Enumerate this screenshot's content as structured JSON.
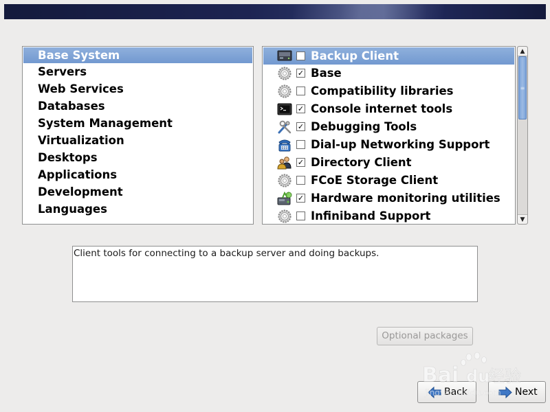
{
  "groups": [
    {
      "label": "Base System",
      "selected": true
    },
    {
      "label": "Servers"
    },
    {
      "label": "Web Services"
    },
    {
      "label": "Databases"
    },
    {
      "label": "System Management"
    },
    {
      "label": "Virtualization"
    },
    {
      "label": "Desktops"
    },
    {
      "label": "Applications"
    },
    {
      "label": "Development"
    },
    {
      "label": "Languages"
    }
  ],
  "packages": [
    {
      "label": "Backup Client",
      "checked": false,
      "icon": "backup-drive-icon",
      "selected": true
    },
    {
      "label": "Base",
      "checked": true,
      "icon": "gear-icon"
    },
    {
      "label": "Compatibility libraries",
      "checked": false,
      "icon": "gear-icon"
    },
    {
      "label": "Console internet tools",
      "checked": true,
      "icon": "terminal-icon"
    },
    {
      "label": "Debugging Tools",
      "checked": true,
      "icon": "tools-icon"
    },
    {
      "label": "Dial-up Networking Support",
      "checked": false,
      "icon": "telephone-icon"
    },
    {
      "label": "Directory Client",
      "checked": true,
      "icon": "users-icon"
    },
    {
      "label": "FCoE Storage Client",
      "checked": false,
      "icon": "gear-icon"
    },
    {
      "label": "Hardware monitoring utilities",
      "checked": true,
      "icon": "hardware-monitor-icon"
    },
    {
      "label": "Infiniband Support",
      "checked": false,
      "icon": "gear-icon"
    }
  ],
  "description": "Client tools for connecting to a backup server and doing backups.",
  "buttons": {
    "optional_packages": "Optional packages",
    "back": "Back",
    "next": "Next"
  },
  "watermark": {
    "text1": "Bai",
    "text2": "du",
    "text3": "经验",
    "url": "jingyan.baidu.com"
  },
  "colors": {
    "selection": "#7299d0",
    "banner": "#1d2452"
  }
}
